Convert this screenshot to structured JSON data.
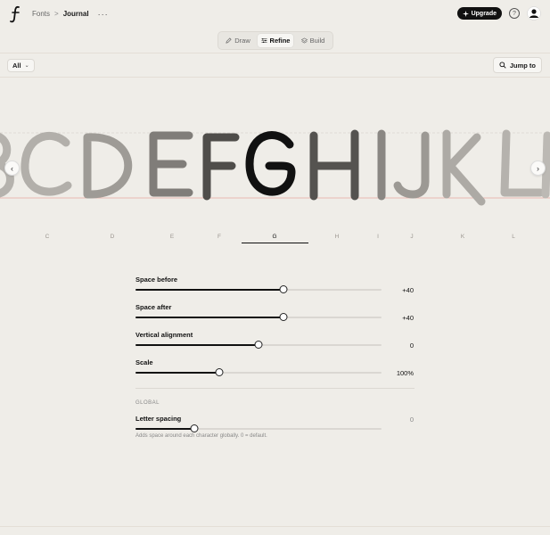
{
  "header": {
    "breadcrumb_root": "Fonts",
    "breadcrumb_sep": ">",
    "breadcrumb_current": "Journal",
    "more": "···",
    "upgrade_label": "Upgrade",
    "help": "?"
  },
  "modes": {
    "draw": "Draw",
    "refine": "Refine",
    "build": "Build"
  },
  "filter": {
    "selected": "All"
  },
  "jump": {
    "label": "Jump to"
  },
  "glyph_index": [
    "C",
    "D",
    "E",
    "F",
    "G",
    "H",
    "I",
    "J",
    "K",
    "L"
  ],
  "selected_glyph": "G",
  "controls": [
    {
      "label": "Space before",
      "value": "+40",
      "level": 0.6
    },
    {
      "label": "Space after",
      "value": "+40",
      "level": 0.6
    },
    {
      "label": "Vertical alignment",
      "value": "0",
      "level": 0.5
    },
    {
      "label": "Scale",
      "value": "100%",
      "level": 0.34
    }
  ],
  "global": {
    "section_title": "GLOBAL",
    "letter_spacing": {
      "label": "Letter spacing",
      "value": "0",
      "level": 0.24
    },
    "hint": "Adds space around each character globally. 0 = default."
  },
  "colors": {
    "accent": "#111111",
    "baseline": "#e8a7a0",
    "background": "#efede8"
  }
}
